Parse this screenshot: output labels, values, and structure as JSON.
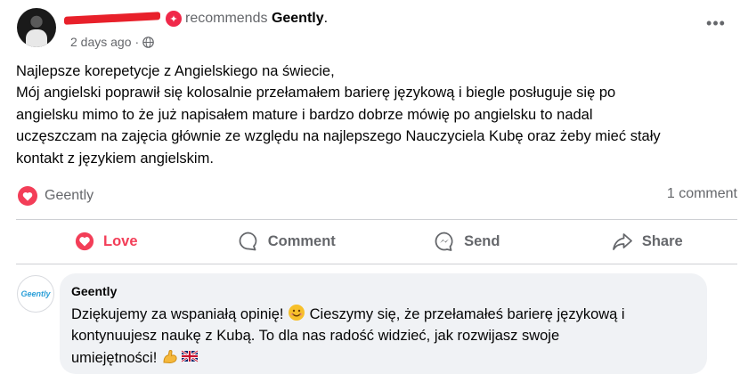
{
  "post": {
    "recommends_text": "recommends",
    "page_name": "Geently",
    "page_name_suffix": ".",
    "time": "2 days ago",
    "separator": "·",
    "more": "•••",
    "lines": [
      "Najlepsze korepetycje z Angielskiego na świecie,",
      "Mój angielski poprawił się kolosalnie przełamałem barierę językową i biegle posługuje się po",
      "angielsku mimo to że już napisałem mature i bardzo dobrze mówię po angielsku to nadal",
      "uczęszczam na zajęcia głównie ze względu na najlepszego Nauczyciela Kubę  oraz żeby mieć stały",
      "kontakt z językiem angielskim."
    ]
  },
  "reactions": {
    "label": "Geently",
    "comment_count": "1 comment"
  },
  "actions": {
    "love": "Love",
    "comment": "Comment",
    "send": "Send",
    "share": "Share"
  },
  "comment": {
    "avatar_text": "Geently",
    "author": "Geently",
    "lines": [
      "Dziękujemy za wspaniałą opinię! ",
      " Cieszymy się, że przełamałeś barierę językową i",
      "kontynuujesz naukę z Kubą. To dla nas radość widzieć, jak rozwijasz swoje",
      "umiejętności! "
    ]
  },
  "colors": {
    "accent_red": "#f33e58",
    "muted": "#65676b",
    "bubble": "#f0f2f5"
  }
}
